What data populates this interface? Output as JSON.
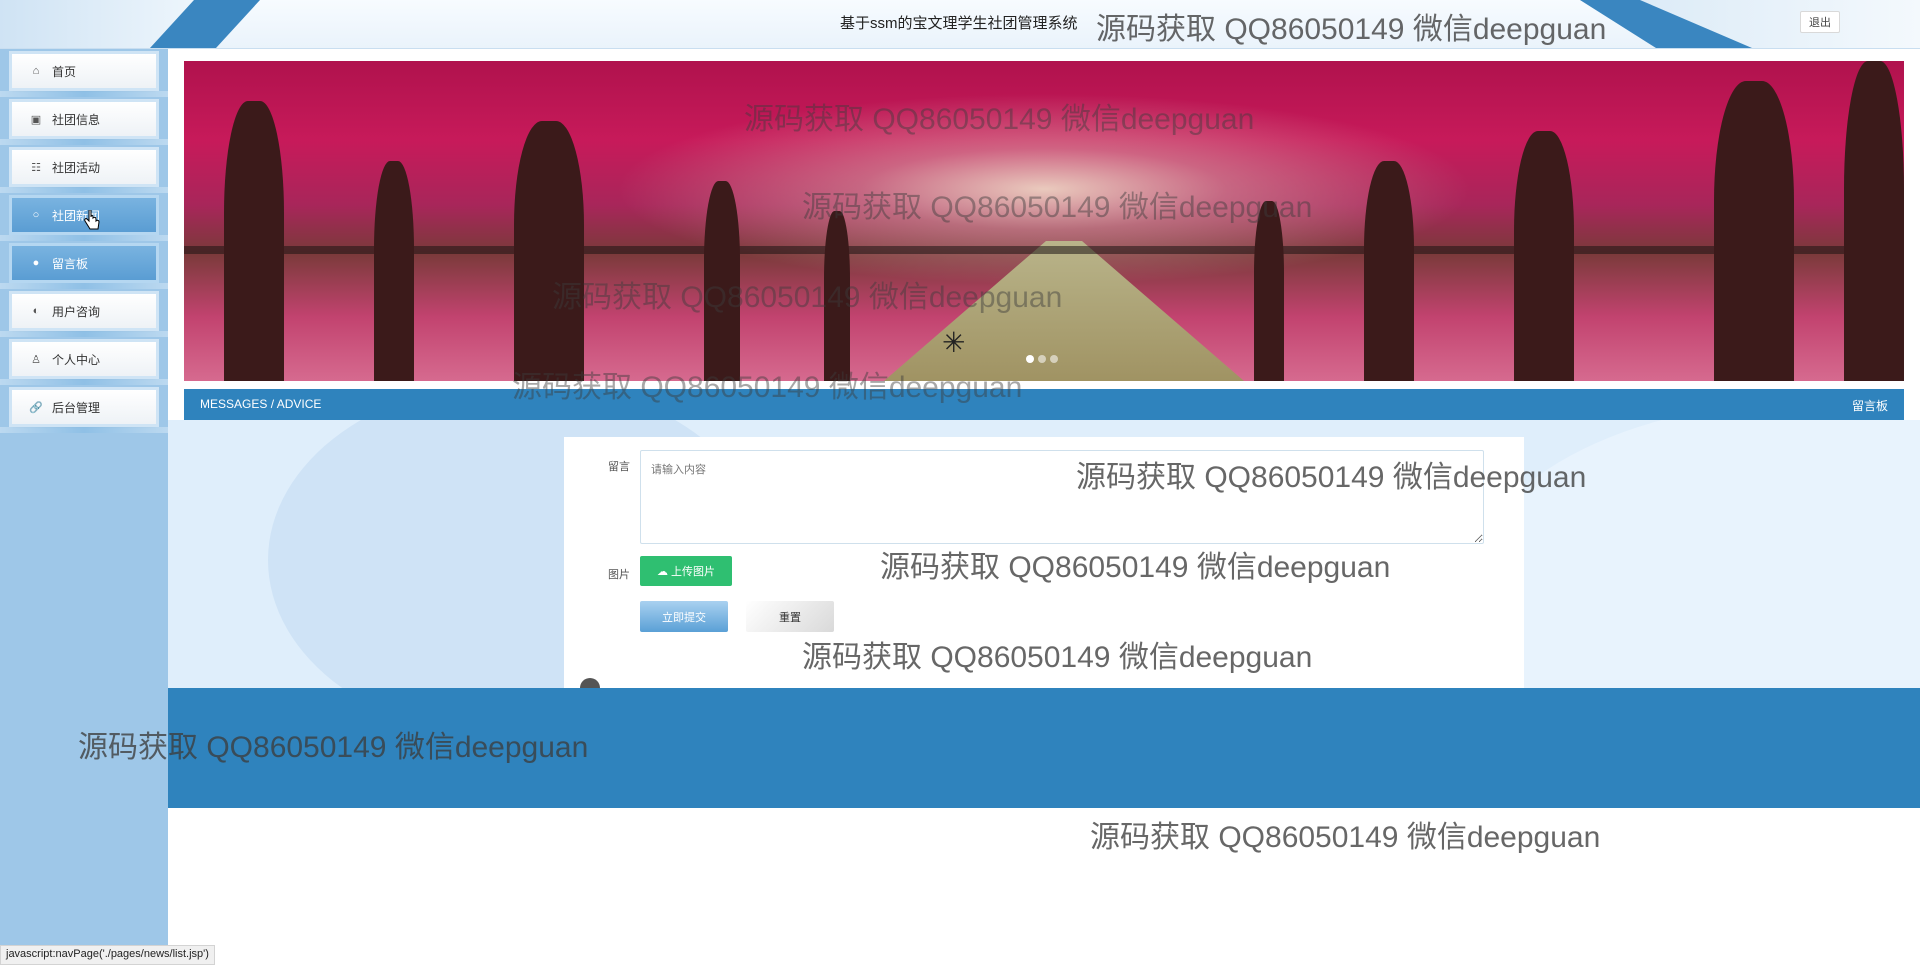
{
  "header": {
    "title": "基于ssm的宝文理学生社团管理系统",
    "logout_label": "退出"
  },
  "sidebar": {
    "items": [
      {
        "label": "首页",
        "icon": "home-icon",
        "glyph": "⌂"
      },
      {
        "label": "社团信息",
        "icon": "info-icon",
        "glyph": "▣"
      },
      {
        "label": "社团活动",
        "icon": "sliders-icon",
        "glyph": "☷"
      },
      {
        "label": "社团新闻",
        "icon": "news-icon",
        "glyph": "○"
      },
      {
        "label": "留言板",
        "icon": "message-icon",
        "glyph": "●"
      },
      {
        "label": "用户咨询",
        "icon": "consult-icon",
        "glyph": "◐"
      },
      {
        "label": "个人中心",
        "icon": "user-icon",
        "glyph": "♙"
      },
      {
        "label": "后台管理",
        "icon": "link-icon",
        "glyph": "🔗"
      }
    ],
    "active_index": 4,
    "hovered_index": 3
  },
  "banner": {
    "slide_count": 3,
    "active_slide": 0,
    "loading_glyph": "✳"
  },
  "section": {
    "title": "MESSAGES / ADVICE",
    "breadcrumb": "留言板"
  },
  "form": {
    "message_label": "留言",
    "message_placeholder": "请输入内容",
    "image_label": "图片",
    "upload_label": "上传图片",
    "submit_label": "立即提交",
    "reset_label": "重置"
  },
  "statusbar": {
    "text": "javascript:navPage('./pages/news/list.jsp')"
  },
  "watermark": {
    "text": "源码获取 QQ86050149 微信deepguan"
  },
  "colors": {
    "accent_blue": "#2f83bd",
    "sidebar_bg": "#9ec7e8",
    "upload_green": "#2fbf71",
    "active_nav": "#5a9dd3"
  }
}
